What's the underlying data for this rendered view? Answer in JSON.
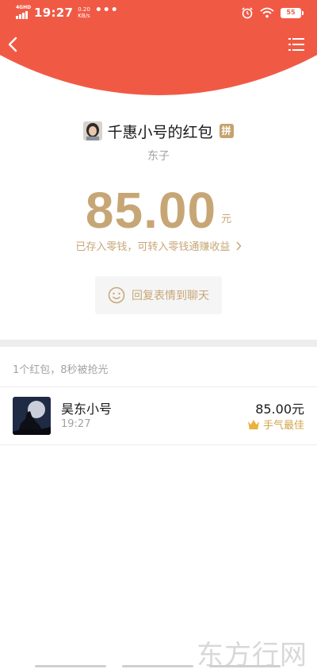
{
  "status_bar": {
    "network": "4GHD",
    "time": "19:27",
    "speed_value": "0.20",
    "speed_unit": "KB/s",
    "more": "•••",
    "battery": "55"
  },
  "nav": {
    "back_icon": "chevron-left-icon",
    "menu_icon": "list-menu-icon"
  },
  "packet": {
    "sender_title": "千惠小号的红包",
    "pin_badge": "拼",
    "greeting": "东子",
    "amount": "85.00",
    "unit": "元",
    "note": "已存入零钱，可转入零钱通赚收益",
    "reply_label": "回复表情到聊天"
  },
  "summary": "1个红包，8秒被抢光",
  "receivers": [
    {
      "name": "昊东小号",
      "time": "19:27",
      "amount": "85.00元",
      "badge": "手气最佳"
    }
  ],
  "watermark": "东方行网",
  "colors": {
    "header_red": "#f05a45",
    "gold": "#c7a676",
    "best_gold": "#d4a44b"
  }
}
